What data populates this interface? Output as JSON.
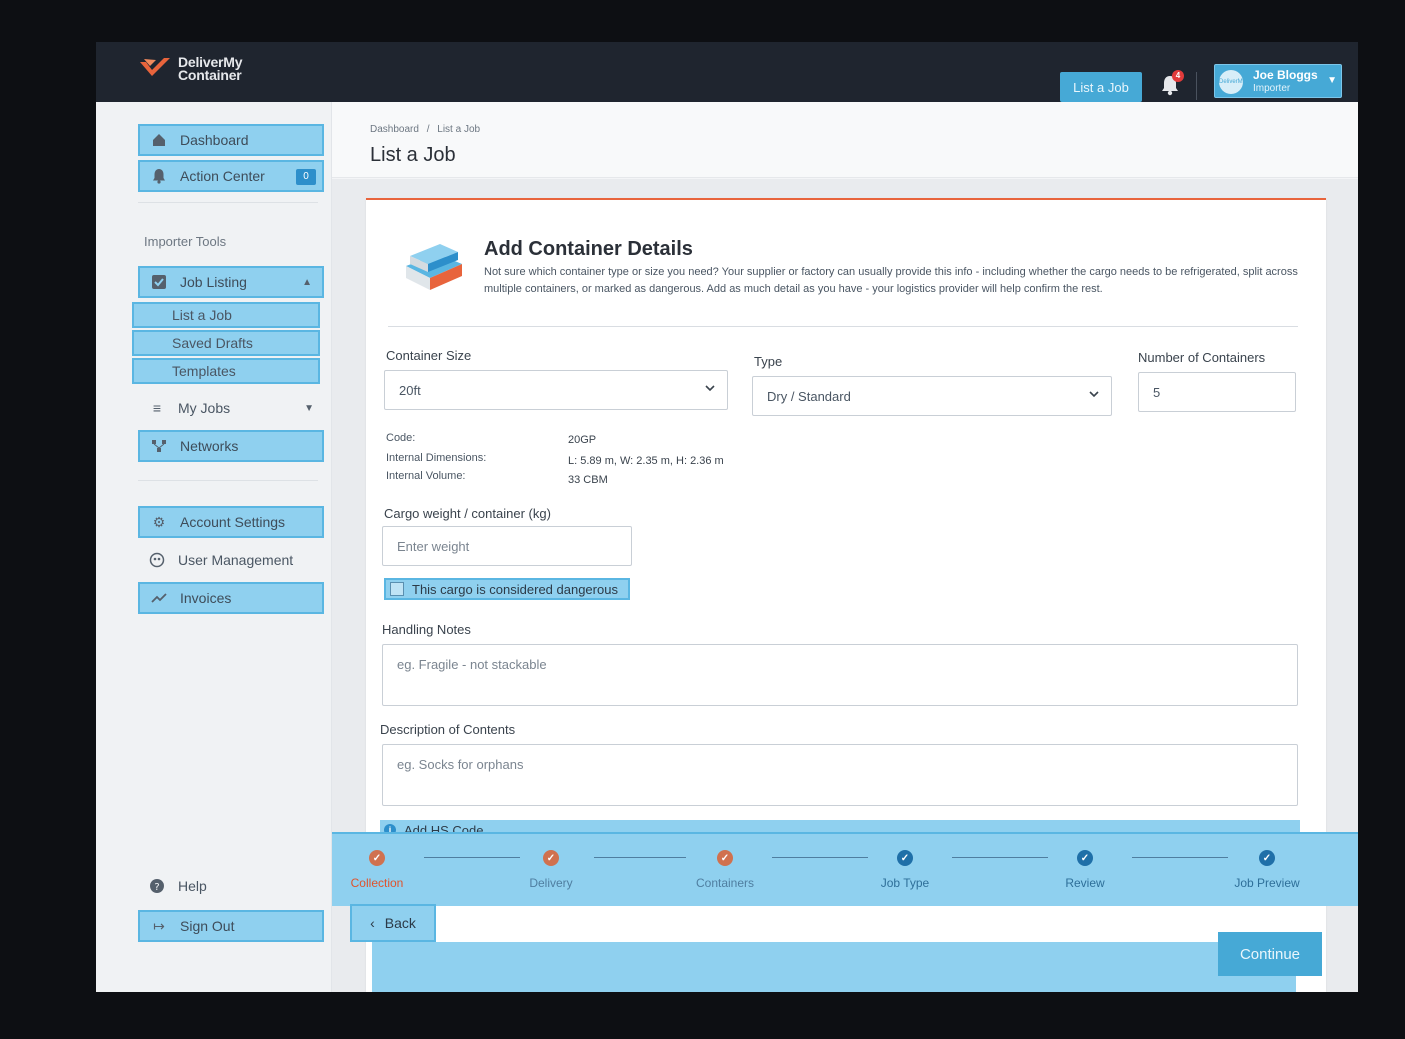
{
  "brand": {
    "name_line1": "DeliverMy",
    "name_line2": "Container",
    "accent": "#e8643c"
  },
  "topbar": {
    "list_job_label": "List a Job",
    "notification_count": "4",
    "user": {
      "initials": "DeliverMy",
      "name": "Joe Bloggs",
      "role": "Importer"
    }
  },
  "sidebar": {
    "dashboard": "Dashboard",
    "action_center": "Action Center",
    "action_center_count": "0",
    "section_title": "Importer Tools",
    "job_listing": "Job Listing",
    "sub_items": [
      "List a Job",
      "Saved Drafts",
      "Templates"
    ],
    "my_jobs": "My Jobs",
    "networks": "Networks",
    "account_settings": "Account Settings",
    "user_management": "User Management",
    "invoices": "Invoices",
    "help": "Help",
    "sign_out": "Sign Out"
  },
  "breadcrumb": {
    "root": "Dashboard",
    "separator": "/",
    "current": "List a Job"
  },
  "page_title": "List a Job",
  "card": {
    "title": "Add Container Details",
    "description": "Not sure which container type or size you need? Your supplier or factory can usually provide this info - including whether the cargo needs to be refrigerated, split across multiple containers, or marked as dangerous. Add as much detail as you have - your logistics provider will help confirm the rest.",
    "container_size": {
      "label": "Container Size",
      "value": "20ft"
    },
    "type": {
      "label": "Type",
      "value": "Dry / Standard"
    },
    "number_of_containers": {
      "label": "Number of Containers",
      "value": "5"
    },
    "specs": [
      {
        "key": "Code:",
        "value": "20GP"
      },
      {
        "key": "Internal Dimensions:",
        "value": "L: 5.89 m, W: 2.35 m, H: 2.36 m"
      },
      {
        "key": "Internal Volume:",
        "value": "33 CBM"
      }
    ],
    "cargo_weight": {
      "label": "Cargo weight / container (kg)",
      "placeholder": "Enter weight"
    },
    "dangerous_label": "This cargo is considered dangerous",
    "handling_notes": {
      "label": "Handling Notes",
      "placeholder": "eg. Fragile - not stackable"
    },
    "description_contents": {
      "label": "Description of Contents",
      "placeholder": "eg. Socks for orphans"
    },
    "add_hs_code": "Add HS Code"
  },
  "stepper": {
    "steps": [
      {
        "label": "Collection",
        "state": "active"
      },
      {
        "label": "Delivery",
        "state": "done"
      },
      {
        "label": "Containers",
        "state": "done"
      },
      {
        "label": "Job Type",
        "state": "todo"
      },
      {
        "label": "Review",
        "state": "todo"
      },
      {
        "label": "Job Preview",
        "state": "todo"
      }
    ]
  },
  "footer": {
    "back_label": "Back",
    "continue_label": "Continue"
  }
}
